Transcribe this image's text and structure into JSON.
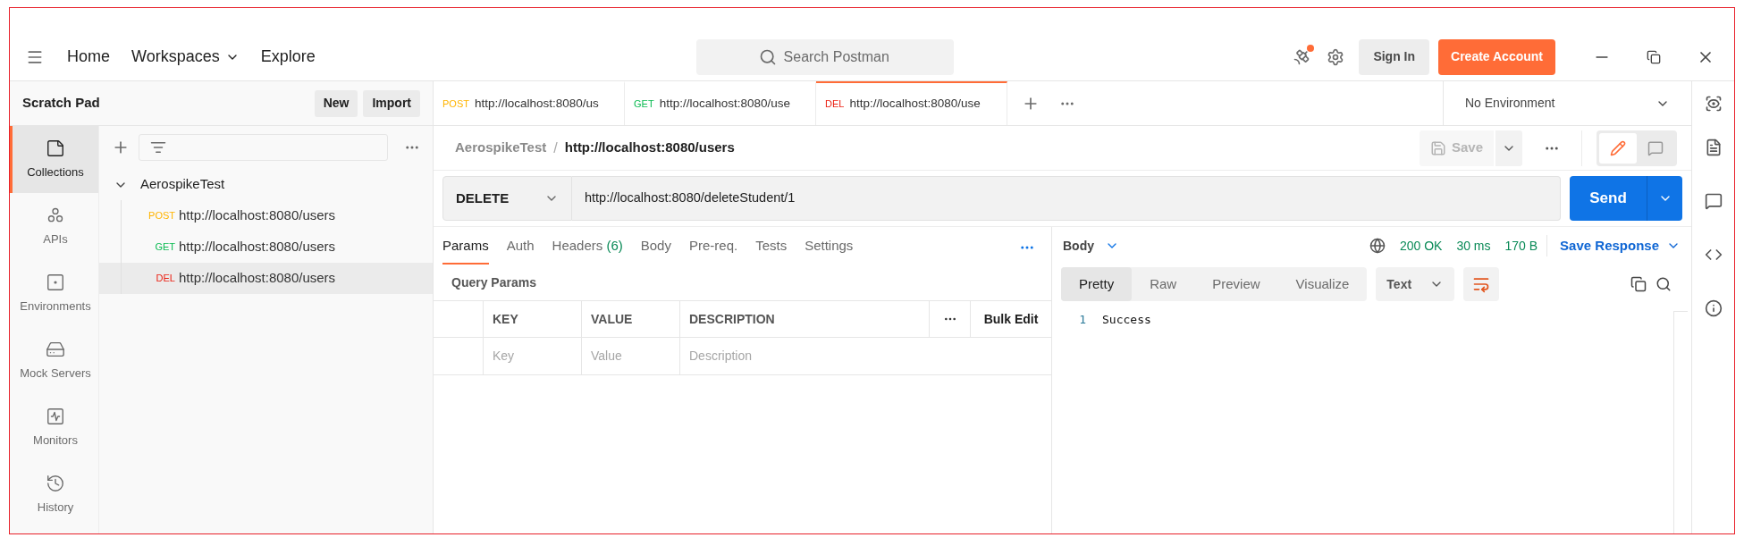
{
  "header": {
    "nav": [
      {
        "label": "Home",
        "dropdown": false
      },
      {
        "label": "Workspaces",
        "dropdown": true
      },
      {
        "label": "Explore",
        "dropdown": false
      }
    ],
    "search": {
      "placeholder": "Search Postman"
    },
    "notification": true,
    "sign_in": "Sign In",
    "create_account": "Create Account"
  },
  "scratch_pad": {
    "title": "Scratch Pad",
    "buttons": [
      "New",
      "Import"
    ]
  },
  "sidebar": {
    "items": [
      {
        "kind": "collections",
        "label": "Collections",
        "selected": true
      },
      {
        "kind": "apis",
        "label": "APIs",
        "selected": false
      },
      {
        "kind": "environments",
        "label": "Environments",
        "selected": false
      },
      {
        "kind": "mock",
        "label": "Mock Servers",
        "selected": false
      },
      {
        "kind": "monitors",
        "label": "Monitors",
        "selected": false
      },
      {
        "kind": "history",
        "label": "History",
        "selected": false
      }
    ]
  },
  "collections": {
    "tree": [
      {
        "name": "AerospikeTest",
        "expanded": true,
        "children": [
          {
            "method": "POST",
            "color": "#ffb400",
            "url": "http://localhost:8080/users",
            "selected": false
          },
          {
            "method": "GET",
            "color": "#0cbb52",
            "url": "http://localhost:8080/users",
            "selected": false
          },
          {
            "method": "DEL",
            "color": "#eb2013",
            "url": "http://localhost:8080/users",
            "selected": true
          }
        ]
      }
    ]
  },
  "tabs": [
    {
      "method": "POST",
      "color": "#ffb400",
      "url": "http://localhost:8080/us",
      "selected": false
    },
    {
      "method": "GET",
      "color": "#0cbb52",
      "url": "http://localhost:8080/use",
      "selected": false
    },
    {
      "method": "DEL",
      "color": "#eb2013",
      "url": "http://localhost:8080/use",
      "selected": true
    }
  ],
  "environment": "No Environment",
  "breadcrumb": {
    "collection": "AerospikeTest",
    "separator": "/",
    "request": "http://localhost:8080/users"
  },
  "mode": [
    {
      "kind": "edit",
      "selected": true
    },
    {
      "kind": "comment",
      "selected": false
    }
  ],
  "save": {
    "label": "Save",
    "disabled": true
  },
  "request": {
    "method": "DELETE",
    "url": "http://localhost:8080/deleteStudent/1",
    "send": "Send"
  },
  "request_tabs": [
    {
      "label": "Params",
      "selected": true
    },
    {
      "label": "Auth",
      "selected": false
    },
    {
      "label": "Headers",
      "count": "(6)",
      "selected": false
    },
    {
      "label": "Body",
      "selected": false
    },
    {
      "label": "Pre-req.",
      "selected": false
    },
    {
      "label": "Tests",
      "selected": false
    },
    {
      "label": "Settings",
      "selected": false
    }
  ],
  "query_params": {
    "title": "Query Params",
    "columns": [
      "KEY",
      "VALUE",
      "DESCRIPTION"
    ],
    "bulk_edit": "Bulk Edit",
    "placeholders": [
      "Key",
      "Value",
      "Description"
    ]
  },
  "response": {
    "view": "Body",
    "status": "200 OK",
    "time": "30 ms",
    "size": "170 B",
    "save_response": "Save Response",
    "formats": [
      {
        "label": "Pretty",
        "selected": true
      },
      {
        "label": "Raw",
        "selected": false
      },
      {
        "label": "Preview",
        "selected": false
      },
      {
        "label": "Visualize",
        "selected": false
      }
    ],
    "language": "Text",
    "lines": [
      {
        "number": "1",
        "text": "Success"
      }
    ]
  }
}
